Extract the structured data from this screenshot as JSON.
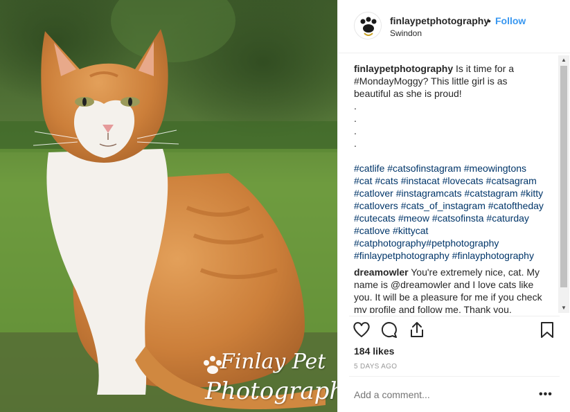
{
  "photo": {
    "watermark_line1": "Finlay Pet",
    "watermark_line2": "Photography"
  },
  "header": {
    "username": "finlaypetphotography",
    "separator": "•",
    "follow_label": "Follow",
    "location": "Swindon"
  },
  "caption": {
    "author": "finlaypetphotography",
    "text": " Is it time for a #MondayMoggy? This little girl is as beautiful as she is proud!\n.\n.\n.\n.",
    "hashtags": "#catlife #catsofinstagram #meowingtons #cat #cats #instacat #lovecats #catsagram #catlover #instagramcats #catstagram #kitty #catlovers #cats_of_instagram #catoftheday #cutecats #meow #catsofinsta #caturday #catlove #kittycat #catphotography#petphotography #finlaypetphotography #finlayphotography"
  },
  "reply": {
    "author": "dreamowler",
    "text": " You're extremely nice, cat. My name is @dreamowler and I love cats like you. It will be a pleasure for me if you check my profile and follow me. Thank you."
  },
  "scrollbar": {
    "up_arrow": "▲",
    "down_arrow": "▼"
  },
  "actions": {
    "like_icon": "heart-icon",
    "comment_icon": "comment-icon",
    "share_icon": "share-icon",
    "save_icon": "bookmark-icon"
  },
  "likes": "184 likes",
  "timestamp": "5 DAYS AGO",
  "add_comment": {
    "placeholder": "Add a comment...",
    "value": ""
  },
  "more_label": "•••",
  "colors": {
    "link": "#3897f0",
    "hashtag": "#003569",
    "muted": "#999999"
  }
}
